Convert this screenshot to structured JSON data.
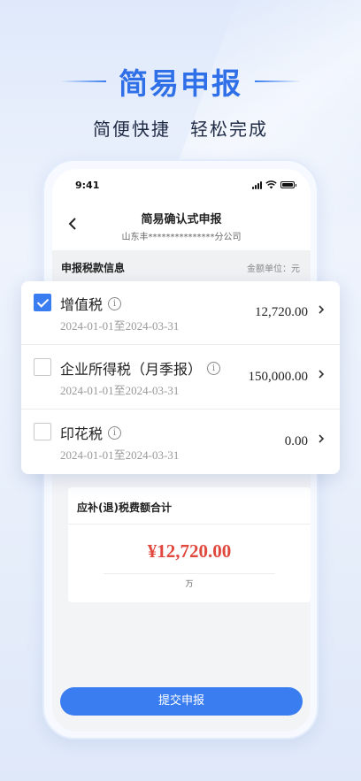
{
  "hero": {
    "title": "简易申报",
    "subtitle": "简便快捷　轻松完成"
  },
  "status_bar": {
    "time": "9:41"
  },
  "nav": {
    "back_icon": "chevron-left-icon",
    "title": "简易确认式申报",
    "subtitle": "山东丰***************分公司"
  },
  "section": {
    "title": "申报税款信息",
    "unit": "金额单位：元"
  },
  "taxes": [
    {
      "name": "增值税",
      "period": "2024-01-01至2024-03-31",
      "amount": "12,720.00",
      "checked": true
    },
    {
      "name": "企业所得税（月季报）",
      "period": "2024-01-01至2024-03-31",
      "amount": "150,000.00",
      "checked": false
    },
    {
      "name": "印花税",
      "period": "2024-01-01至2024-03-31",
      "amount": "0.00",
      "checked": false
    }
  ],
  "total": {
    "title": "应补(退)税费额合计",
    "value": "¥12,720.00",
    "unit": "万"
  },
  "submit_label": "提交申报",
  "colors": {
    "accent": "#3a7df0",
    "total": "#e0483e"
  }
}
